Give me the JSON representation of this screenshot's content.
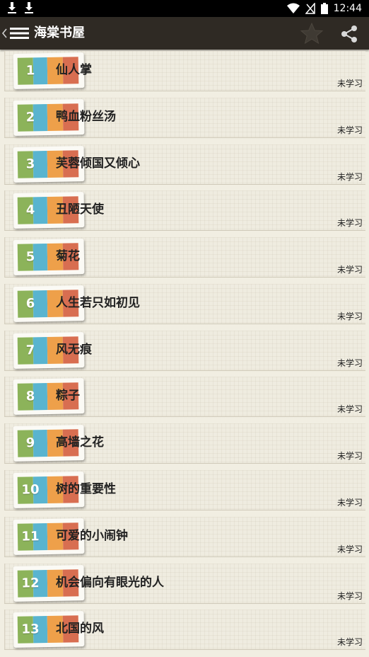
{
  "status_bar": {
    "time": "12:44",
    "icons": [
      "download-icon",
      "download-icon",
      "wifi-icon",
      "no-signal-icon",
      "battery-icon"
    ]
  },
  "app_bar": {
    "title": "海棠书屋",
    "icons": [
      "back-chevron-icon",
      "menu-icon",
      "star-icon",
      "share-icon"
    ]
  },
  "lessons": [
    {
      "num": "1",
      "title": "仙人掌",
      "status": "未学习"
    },
    {
      "num": "2",
      "title": "鸭血粉丝汤",
      "status": "未学习"
    },
    {
      "num": "3",
      "title": "芙蓉倾国又倾心",
      "status": "未学习"
    },
    {
      "num": "4",
      "title": "丑陋天使",
      "status": "未学习"
    },
    {
      "num": "5",
      "title": "菊花",
      "status": "未学习"
    },
    {
      "num": "6",
      "title": "人生若只如初见",
      "status": "未学习"
    },
    {
      "num": "7",
      "title": "风无痕",
      "status": "未学习"
    },
    {
      "num": "8",
      "title": "粽子",
      "status": "未学习"
    },
    {
      "num": "9",
      "title": "高墙之花",
      "status": "未学习"
    },
    {
      "num": "10",
      "title": "树的重要性",
      "status": "未学习"
    },
    {
      "num": "11",
      "title": "可爱的小闹钟",
      "status": "未学习"
    },
    {
      "num": "12",
      "title": "机会偏向有眼光的人",
      "status": "未学习"
    },
    {
      "num": "13",
      "title": "北国的风",
      "status": "未学习"
    }
  ],
  "colors": {
    "appbar": "#2f2a24",
    "badge_green": "#8cb35a",
    "badge_blue": "#59b4cf",
    "badge_orange": "#eea04a",
    "badge_red": "#d86e51"
  }
}
